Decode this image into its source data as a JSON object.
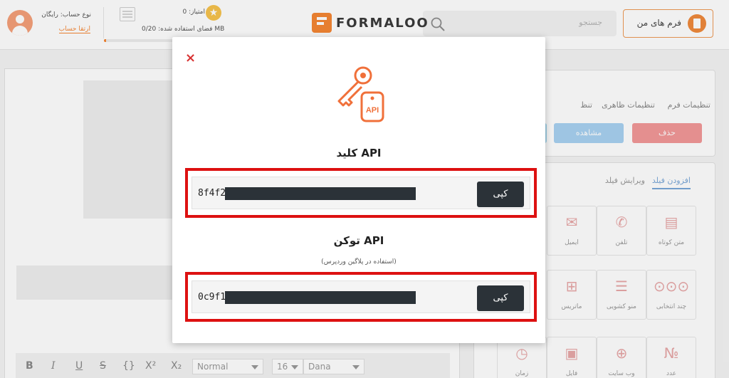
{
  "header": {
    "my_forms_label": "فرم های من",
    "search_placeholder": "جستجو",
    "logo_text": "FORMALOO",
    "score_text": "امتیاز: 0",
    "storage_text": "فضای استفاده شده: 0/20 MB",
    "storage_fraction": 0.02,
    "account_type": "نوع حساب: رایگان",
    "upgrade_link": "ارتقا حساب"
  },
  "right_panel": {
    "tabs": [
      "تنظیمات فرم",
      "تنظیمات ظاهری",
      "تنظ"
    ],
    "delete_label": "حذف",
    "preview_label": "مشاهده"
  },
  "fields_panel": {
    "tabs": [
      "افزودن فیلد",
      "ویرایش فیلد"
    ],
    "tiles": [
      "متن کوتاه",
      "تلفن",
      "ایمیل",
      "چند انتخابی",
      "منو کشویی",
      "ماتریس",
      "عدد",
      "وب سایت",
      "فایل",
      "زمان"
    ]
  },
  "editor_toolbar": {
    "bold": "B",
    "italic": "I",
    "underline": "U",
    "strike": "S",
    "code": "{}",
    "superscript": "X²",
    "subscript": "X₂",
    "style_select": "Normal",
    "size_select": "16",
    "font_select": "Dana"
  },
  "modal": {
    "close": "×",
    "api_key_title": "کلید API",
    "api_key_prefix": "8f4f2",
    "api_token_title": "توکن API",
    "api_token_subtitle": "(استفاده در پلاگین وردپرس)",
    "api_token_prefix": "0c9f1",
    "copy_label": "کپی",
    "illustration_label": "API"
  },
  "colors": {
    "accent": "#f58634",
    "redaction": "#2b3238",
    "highlight_frame": "#dd1111"
  }
}
